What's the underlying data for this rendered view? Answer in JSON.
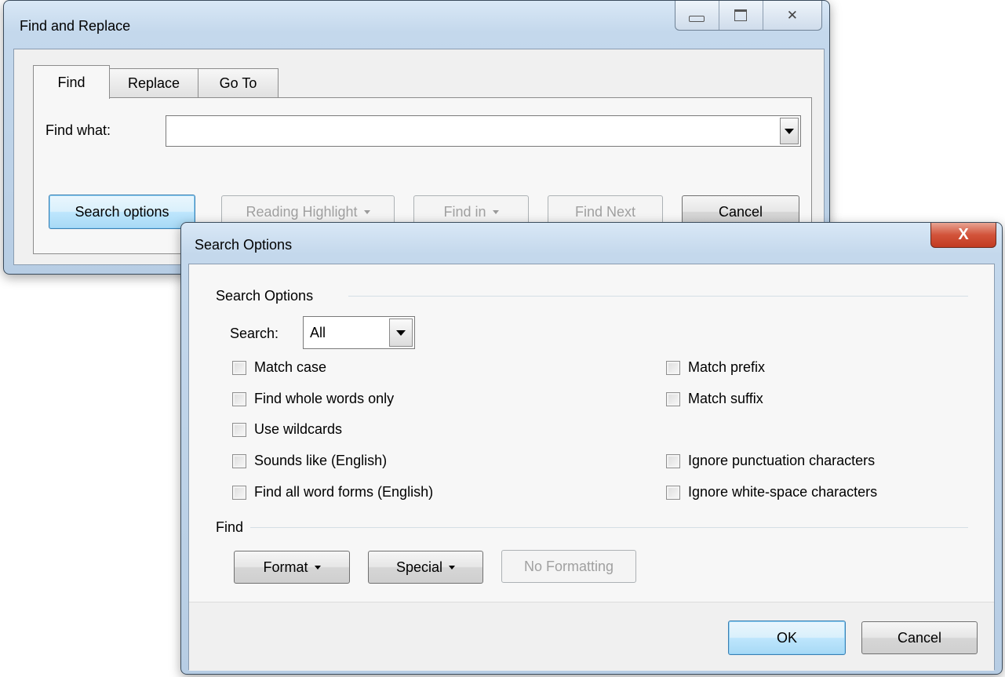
{
  "find_replace": {
    "title": "Find and Replace",
    "tabs": [
      {
        "label": "Find",
        "active": true
      },
      {
        "label": "Replace",
        "active": false
      },
      {
        "label": "Go To",
        "active": false
      }
    ],
    "find_what_label": "Find what:",
    "find_what_value": "",
    "buttons": {
      "search_options": "Search options",
      "reading_highlight": "Reading Highlight",
      "find_in": "Find in",
      "find_next": "Find Next",
      "cancel": "Cancel"
    }
  },
  "search_options": {
    "title": "Search Options",
    "close_glyph": "X",
    "group_search_label": "Search Options",
    "search_label": "Search:",
    "search_value": "All",
    "checkboxes_left": [
      {
        "label": "Match case",
        "checked": false
      },
      {
        "label": "Find whole words only",
        "checked": false
      },
      {
        "label": "Use wildcards",
        "checked": false
      },
      {
        "label": "Sounds like (English)",
        "checked": false
      },
      {
        "label": "Find all word forms (English)",
        "checked": false
      }
    ],
    "checkboxes_right": [
      {
        "label": "Match prefix",
        "checked": false
      },
      {
        "label": "Match suffix",
        "checked": false
      },
      {
        "label": "Ignore punctuation characters",
        "checked": false
      },
      {
        "label": "Ignore white-space characters",
        "checked": false
      }
    ],
    "group_find_label": "Find",
    "buttons": {
      "format": "Format",
      "special": "Special",
      "no_formatting": "No Formatting",
      "ok": "OK",
      "cancel": "Cancel"
    }
  }
}
